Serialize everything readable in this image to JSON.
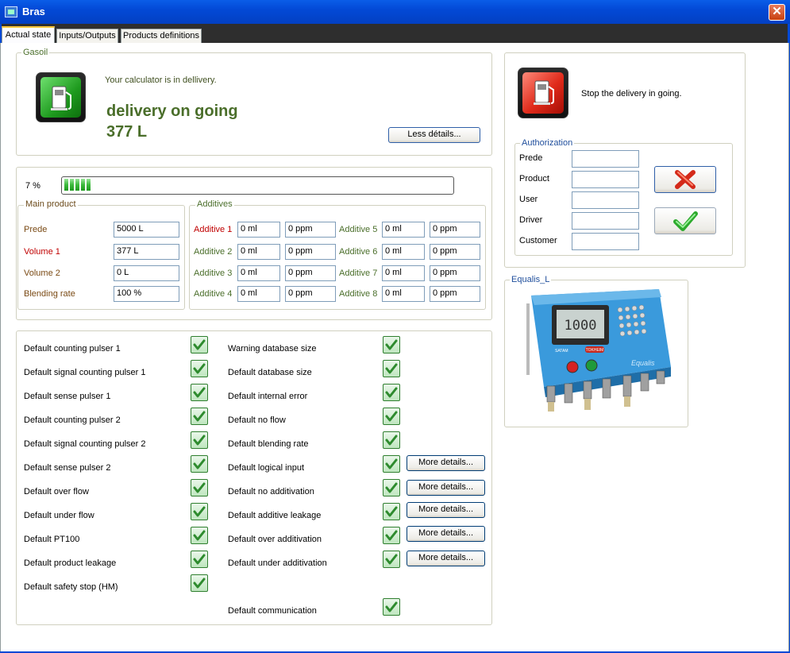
{
  "window": {
    "title": "Bras",
    "close_glyph": "✕"
  },
  "tabs": [
    {
      "label": "Actual state",
      "active": true
    },
    {
      "label": "Inputs/Outputs",
      "active": false
    },
    {
      "label": "Products definitions",
      "active": false
    }
  ],
  "gasoil": {
    "legend": "Gasoil",
    "status_text": "Your calculator is in dellivery.",
    "headline": "delivery on going",
    "volume": "377 L",
    "less_details_label": "Less détails...",
    "icon": "fuel-pump-icon"
  },
  "progress": {
    "label": "7 %",
    "percent": 7
  },
  "main_product": {
    "legend": "Main product",
    "rows": [
      {
        "label": "Prede",
        "value": "5000 L"
      },
      {
        "label": "Volume 1",
        "value": "377 L"
      },
      {
        "label": "Volume 2",
        "value": "0 L"
      },
      {
        "label": "Blending rate",
        "value": "100 %"
      }
    ]
  },
  "additives": {
    "legend": "Additives",
    "items": [
      {
        "label": "Additive 1",
        "ml": "0 ml",
        "ppm": "0 ppm"
      },
      {
        "label": "Additive 2",
        "ml": "0 ml",
        "ppm": "0 ppm"
      },
      {
        "label": "Additive 3",
        "ml": "0 ml",
        "ppm": "0 ppm"
      },
      {
        "label": "Additive 4",
        "ml": "0 ml",
        "ppm": "0 ppm"
      },
      {
        "label": "Additive 5",
        "ml": "0 ml",
        "ppm": "0 ppm"
      },
      {
        "label": "Additive 6",
        "ml": "0 ml",
        "ppm": "0 ppm"
      },
      {
        "label": "Additive 7",
        "ml": "0 ml",
        "ppm": "0 ppm"
      },
      {
        "label": "Additive 8",
        "ml": "0 ml",
        "ppm": "0 ppm"
      }
    ]
  },
  "defaults_left": [
    "Default counting pulser 1",
    "Default signal counting pulser 1",
    "Default sense pulser 1",
    "Default counting pulser 2",
    "Default signal counting pulser 2",
    "Default sense pulser 2",
    "Default over flow",
    "Default under flow",
    "Default PT100",
    "Default product leakage",
    "Default safety stop (HM)"
  ],
  "defaults_right": [
    "Warning database size",
    "Default database size",
    "Default internal error",
    "Default no flow",
    "Default blending rate",
    "Default logical input",
    "Default no additivation",
    "Default additive leakage",
    "Default over additivation",
    "Default under additivation",
    "Default communication"
  ],
  "more_details_label": "More details...",
  "stop": {
    "text": "Stop the delivery in going.",
    "icon": "stop-fuel-pump-icon"
  },
  "authorization": {
    "legend": "Authorization",
    "fields": [
      {
        "label": "Prede",
        "value": ""
      },
      {
        "label": "Product",
        "value": ""
      },
      {
        "label": "User",
        "value": ""
      },
      {
        "label": "Driver",
        "value": ""
      },
      {
        "label": "Customer",
        "value": ""
      }
    ],
    "cancel_icon": "red-x-icon",
    "ok_icon": "green-check-icon"
  },
  "device": {
    "legend": "Equalis_L",
    "display_value": "1000",
    "brand_text": "SATAM",
    "badge_text": "TOKHEIM",
    "name_text": "Equalis"
  },
  "colors": {
    "accent_green": "#4A6E2A",
    "title_blue": "#0349D6",
    "alarm_red": "#C00000"
  }
}
